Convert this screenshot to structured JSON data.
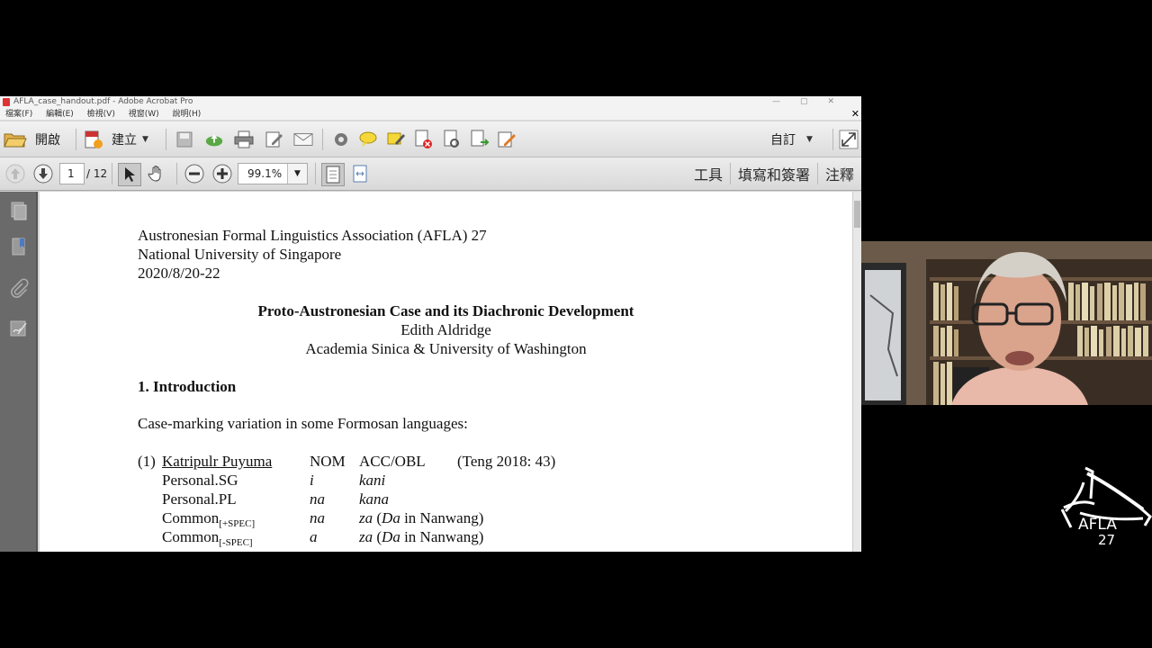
{
  "window": {
    "title": "AFLA_case_handout.pdf - Adobe Acrobat Pro",
    "controls": [
      "—",
      "▢",
      "✕"
    ],
    "close_glyph": "✕"
  },
  "menu": [
    "檔案(F)",
    "編輯(E)",
    "檢視(V)",
    "視窗(W)",
    "說明(H)"
  ],
  "toolbar": {
    "open_label": "開啟",
    "create_label": "建立",
    "customize_label": "自訂",
    "icons": [
      "folder-open-icon",
      "create-pdf-icon",
      "save-icon",
      "upload-cloud-icon",
      "print-icon",
      "edit-icon",
      "email-icon",
      "gear-icon",
      "comment-icon",
      "highlight-icon",
      "delete-pdf-icon",
      "document-icon",
      "export-icon",
      "sign-icon",
      "fullscreen-icon"
    ]
  },
  "nav": {
    "page_current": "1",
    "page_total": "/ 12",
    "zoom": "99.1%",
    "tools_label": "工具",
    "fill_sign_label": "填寫和簽署",
    "comment_label": "注釋"
  },
  "document": {
    "header_lines": [
      "Austronesian Formal Linguistics Association (AFLA) 27",
      "National University of Singapore",
      "2020/8/20-22"
    ],
    "title": "Proto-Austronesian Case and its Diachronic Development",
    "author": "Edith Aldridge",
    "affiliation": "Academia Sinica & University of Washington",
    "section_heading": "1. Introduction",
    "intro_text": "Case-marking variation in some Formosan languages:",
    "example": {
      "number": "(1)",
      "language": "Katripulr Puyuma",
      "col_nom": "NOM",
      "col_acc": "ACC/OBL",
      "citation": "(Teng 2018: 43)",
      "rows": [
        {
          "label": "Personal.SG",
          "sub": "",
          "nom": "i",
          "acc": "kani",
          "acc_rest": ""
        },
        {
          "label": "Personal.PL",
          "sub": "",
          "nom": "na",
          "acc": "kana",
          "acc_rest": ""
        },
        {
          "label": "Common",
          "sub": "[+SPEC]",
          "nom": "na",
          "acc": "za",
          "acc_rest_open": " (",
          "acc_rest_it": "Da",
          "acc_rest_close": " in Nanwang)"
        },
        {
          "label": "Common",
          "sub": "[-SPEC]",
          "nom": "a",
          "acc": "za",
          "acc_rest_open": " (",
          "acc_rest_it": "Da",
          "acc_rest_close": " in Nanwang)"
        }
      ]
    }
  },
  "logo": {
    "text": "AFLA",
    "number": "27"
  },
  "colors": {
    "toolbar_bg": "#e4e4e4",
    "left_panel": "#6a6a6a",
    "doc_bg": "#6d6d6d",
    "page_bg": "#ffffff",
    "background": "#000000"
  }
}
